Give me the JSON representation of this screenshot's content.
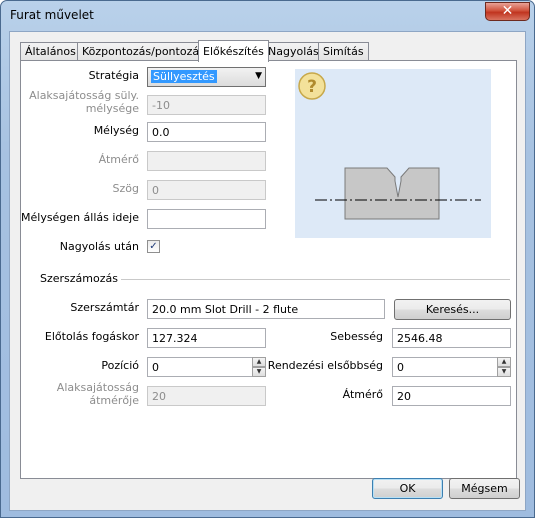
{
  "window": {
    "title": "Furat művelet",
    "close_glyph": "✕"
  },
  "tabs": [
    {
      "label": "Általános"
    },
    {
      "label": "Központozás/pontozás"
    },
    {
      "label": "Előkészítés"
    },
    {
      "label": "Nagyolás"
    },
    {
      "label": "Simítás"
    }
  ],
  "active_tab": "Előkészítés",
  "preparation": {
    "strategy_label": "Stratégia",
    "strategy_value": "Süllyesztés",
    "undercut_depth_label_1": "Alaksajátosság süly.",
    "undercut_depth_label_2": "mélysége",
    "undercut_depth_value": "-10",
    "depth_label": "Mélység",
    "depth_value": "0.0",
    "diameter_label": "Átmérő",
    "diameter_value": "",
    "angle_label": "Szög",
    "angle_value": "0",
    "dwell_label": "Mélységen állás ideje",
    "dwell_value": "",
    "after_roughing_label": "Nagyolás után",
    "after_roughing_checked": true
  },
  "preview": {
    "help_icon": "?"
  },
  "tooling": {
    "group_title": "Szerszámozás",
    "tool_library_label": "Szerszámtár",
    "tool_library_value": "20.0 mm Slot Drill - 2 flute",
    "search_button": "Keresés...",
    "feed_per_tooth_label": "Előtolás fogáskor",
    "feed_per_tooth_value": "127.324",
    "speed_label": "Sebesség",
    "speed_value": "2546.48",
    "position_label": "Pozíció",
    "position_value": "0",
    "sort_priority_label": "Rendezési elsőbbség",
    "sort_priority_value": "0",
    "feature_diameter_label_1": "Alaksajátosság",
    "feature_diameter_label_2": "átmérője",
    "feature_diameter_value": "20",
    "diameter_label": "Átmérő",
    "diameter_value": "20"
  },
  "footer": {
    "ok_label": "OK",
    "cancel_label": "Mégsem"
  }
}
